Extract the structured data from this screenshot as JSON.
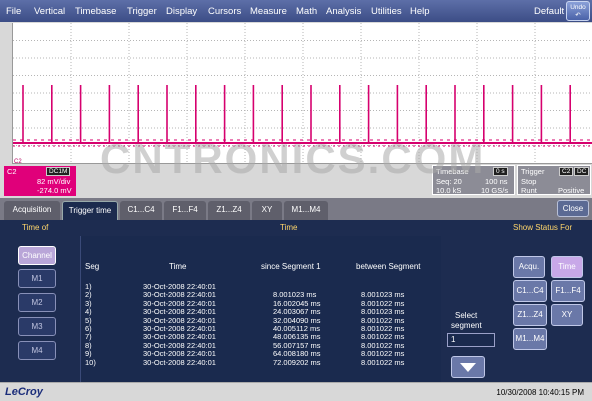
{
  "menu": [
    "File",
    "Vertical",
    "Timebase",
    "Trigger",
    "Display",
    "Cursors",
    "Measure",
    "Math",
    "Analysis",
    "Utilities",
    "Help"
  ],
  "menu_right": "Default",
  "undo_label": "Undo",
  "channel_marker": "C2",
  "channel_box": {
    "name": "C2",
    "coupling": "DC1M",
    "scale": "82 mV/div",
    "offset": "-274.0 mV"
  },
  "timebase_box": {
    "title": "Timebase",
    "value0": "0 s",
    "seq_label": "Seq: 20",
    "seq_value": "100 ns",
    "samples": "10.0 kS",
    "rate": "10 GS/s"
  },
  "trigger_box": {
    "title": "Trigger",
    "channel": "C2",
    "coupling": "DC",
    "mode": "Stop",
    "source": "Runt",
    "slope": "Positive"
  },
  "tabs": [
    "Acquisition",
    "Trigger time",
    "C1...C4",
    "F1...F4",
    "Z1...Z4",
    "XY",
    "M1...M4"
  ],
  "close_label": "Close",
  "panel": {
    "time_of_label": "Time of",
    "time_label": "Time",
    "show_status_label": "Show Status For",
    "time_of_buttons": [
      "Channel",
      "M1",
      "M2",
      "M3",
      "M4"
    ],
    "columns": [
      "Seg",
      "Time",
      "since Segment 1",
      "between Segment"
    ],
    "rows": [
      {
        "seg": "1)",
        "time": "30-Oct-2008  22:40:01",
        "since": "",
        "between": ""
      },
      {
        "seg": "2)",
        "time": "30-Oct-2008  22:40:01",
        "since": "8.001023 ms",
        "between": "8.001023 ms"
      },
      {
        "seg": "3)",
        "time": "30-Oct-2008  22:40:01",
        "since": "16.002045 ms",
        "between": "8.001022 ms"
      },
      {
        "seg": "4)",
        "time": "30-Oct-2008  22:40:01",
        "since": "24.003067 ms",
        "between": "8.001023 ms"
      },
      {
        "seg": "5)",
        "time": "30-Oct-2008  22:40:01",
        "since": "32.004090 ms",
        "between": "8.001022 ms"
      },
      {
        "seg": "6)",
        "time": "30-Oct-2008  22:40:01",
        "since": "40.005112 ms",
        "between": "8.001022 ms"
      },
      {
        "seg": "7)",
        "time": "30-Oct-2008  22:40:01",
        "since": "48.006135 ms",
        "between": "8.001022 ms"
      },
      {
        "seg": "8)",
        "time": "30-Oct-2008  22:40:01",
        "since": "56.007157 ms",
        "between": "8.001022 ms"
      },
      {
        "seg": "9)",
        "time": "30-Oct-2008  22:40:01",
        "since": "64.008180 ms",
        "between": "8.001022 ms"
      },
      {
        "seg": "10)",
        "time": "30-Oct-2008  22:40:01",
        "since": "72.009202 ms",
        "between": "8.001022 ms"
      }
    ],
    "select_segment_line1": "Select",
    "select_segment_line2": "segment",
    "segment_value": "1",
    "status_buttons": [
      "Acqu.",
      "Time",
      "C1...C4",
      "F1...F4",
      "Z1...Z4",
      "XY",
      "M1...M4"
    ]
  },
  "brand": "LeCroy",
  "datetime": "10/30/2008 10:40:15 PM",
  "watermark": "CNTRONICS.COM",
  "colors": {
    "trace": "#d6006e",
    "panel_bg": "#1d2c50",
    "menubar": "#4a5b94",
    "heading": "#ffd66b"
  }
}
